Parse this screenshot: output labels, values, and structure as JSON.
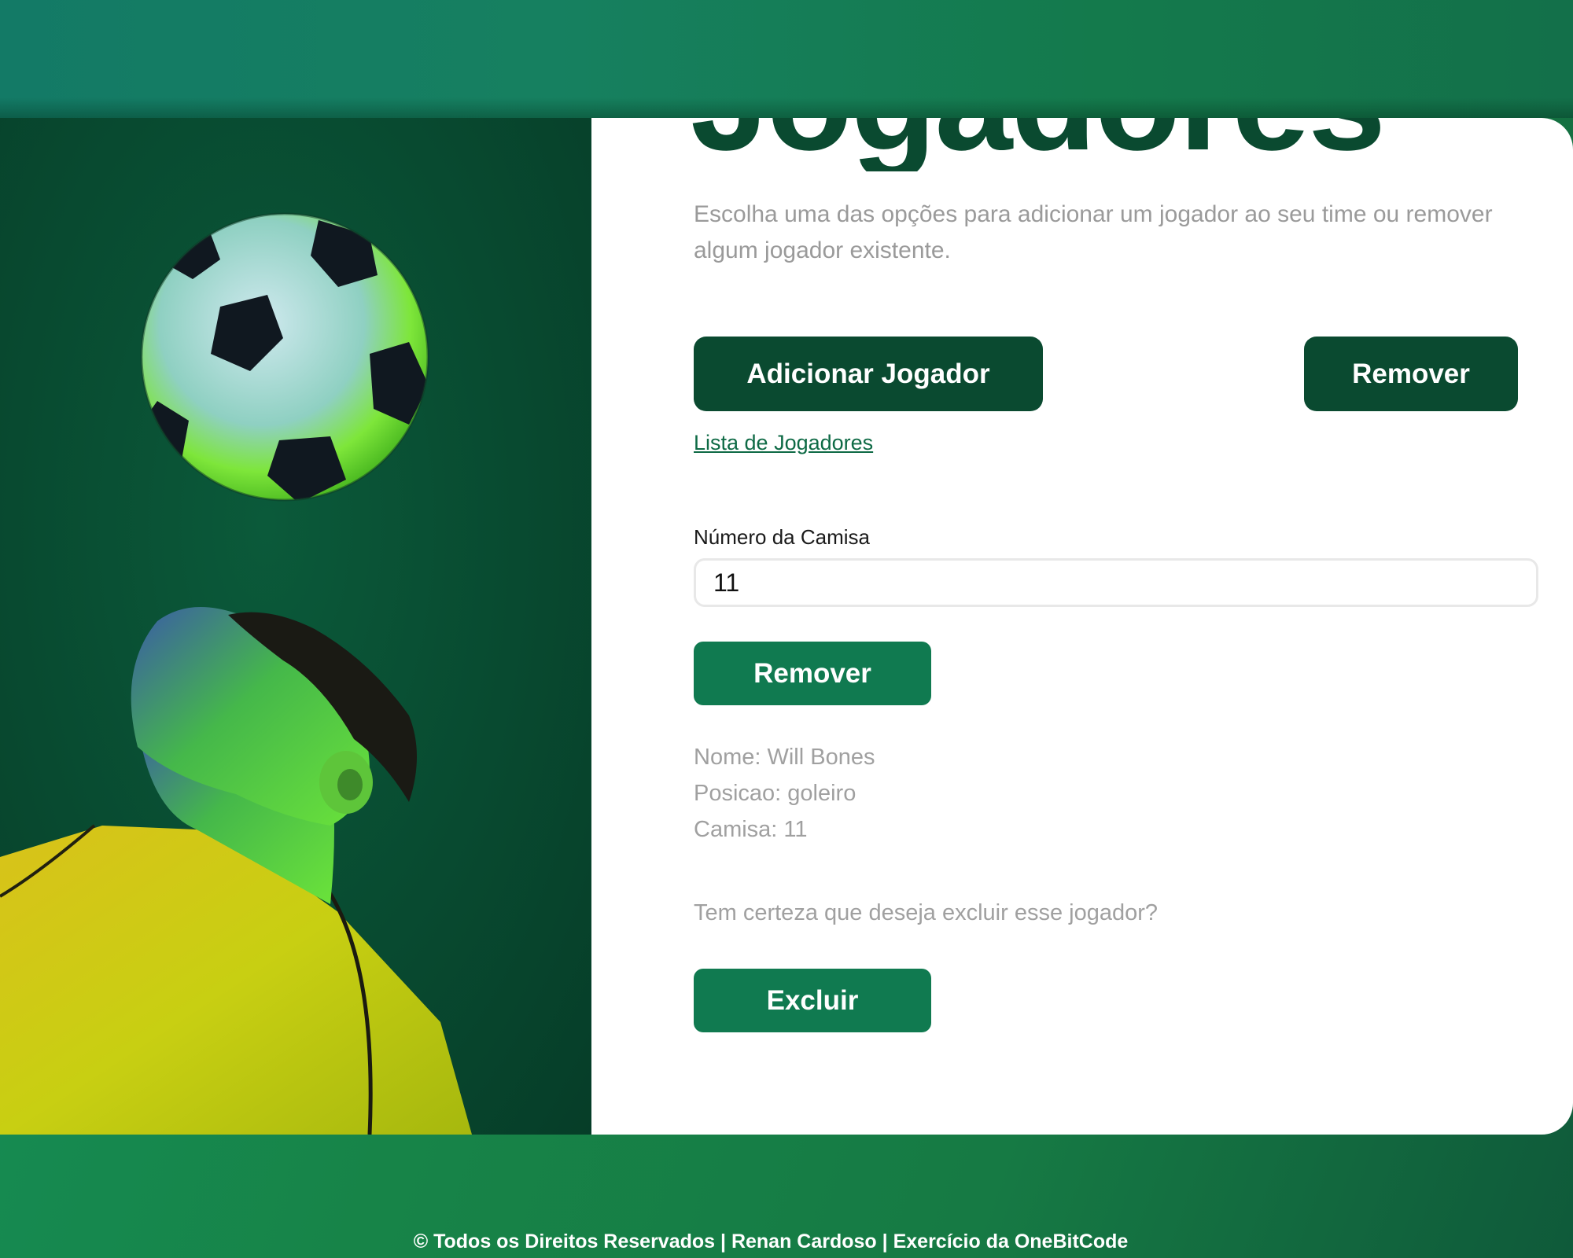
{
  "header": {
    "page_title": "Jogadores"
  },
  "intro": {
    "description": "Escolha uma das opções para adicionar um jogador ao seu time ou remover algum jogador existente."
  },
  "actions": {
    "add_label": "Adicionar Jogador",
    "remove_mode_label": "Remover",
    "list_link_label": "Lista de Jogadores"
  },
  "form": {
    "shirt_label": "Número da Camisa",
    "shirt_value": "11",
    "remove_button_label": "Remover"
  },
  "player": {
    "name_line": "Nome: Will Bones",
    "position_line": "Posicao: goleiro",
    "shirt_line": "Camisa: 11"
  },
  "confirm": {
    "question": "Tem certeza que deseja excluir esse jogador?",
    "delete_button_label": "Excluir"
  },
  "footer": {
    "text": "© Todos os Direitos Reservados | Renan Cardoso | Exercício da OneBitCode"
  },
  "colors": {
    "primary_dark": "#0a4a30",
    "primary": "#107a50",
    "muted_text": "#a0a0a0"
  },
  "icons": {
    "photo": "soccer-player-photo"
  }
}
